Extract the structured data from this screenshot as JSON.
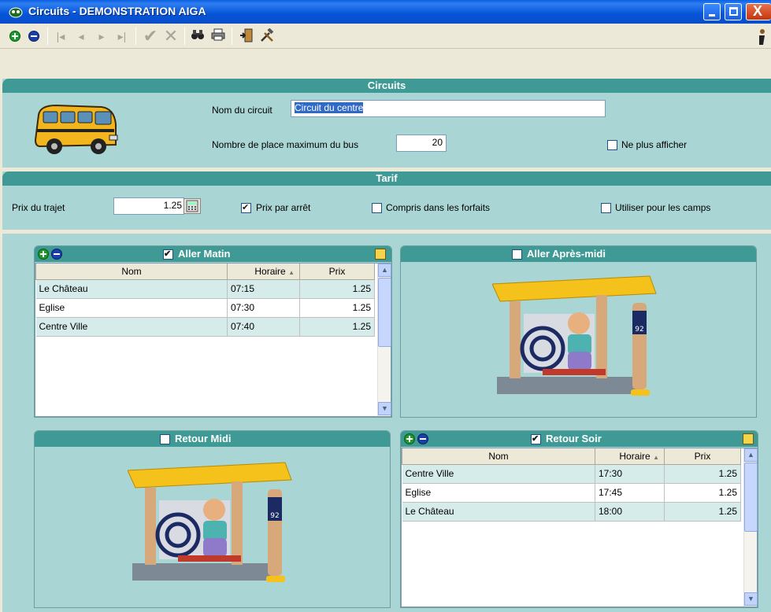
{
  "window": {
    "title": "Circuits - DEMONSTRATION AIGA",
    "close_glyph": "X"
  },
  "toolbar": {
    "icons": [
      "add-icon",
      "remove-icon",
      "first-icon",
      "previous-icon",
      "next-icon",
      "last-icon",
      "validate-icon",
      "cancel-icon",
      "search-icon",
      "print-icon",
      "exit-icon",
      "tools-icon",
      "info-icon"
    ]
  },
  "circuits": {
    "header": "Circuits",
    "name_label": "Nom du circuit",
    "name_value": "Circuit du centre",
    "max_seats_label": "Nombre de place maximum du bus",
    "max_seats_value": "20",
    "hide_label": "Ne plus afficher"
  },
  "tarif": {
    "header": "Tarif",
    "price_label": "Prix du trajet",
    "price_value": "1.25",
    "per_stop_label": "Prix par arrêt",
    "per_stop_checked": true,
    "forfaits_label": "Compris dans les forfaits",
    "camps_label": "Utiliser pour les camps"
  },
  "aller_matin": {
    "title": "Aller Matin",
    "checked": true,
    "columns": [
      "Nom",
      "Horaire",
      "Prix"
    ],
    "sort_glyph": "▲",
    "rows": [
      {
        "nom": "Le Château",
        "horaire": "07:15",
        "prix": "1.25"
      },
      {
        "nom": "Eglise",
        "horaire": "07:30",
        "prix": "1.25"
      },
      {
        "nom": "Centre Ville",
        "horaire": "07:40",
        "prix": "1.25"
      }
    ]
  },
  "aller_apres_midi": {
    "title": "Aller Après-midi",
    "checked": false,
    "sign_number": "92"
  },
  "retour_midi": {
    "title": "Retour Midi",
    "checked": false,
    "sign_number": "92"
  },
  "retour_soir": {
    "title": "Retour Soir",
    "checked": true,
    "columns": [
      "Nom",
      "Horaire",
      "Prix"
    ],
    "sort_glyph": "▲",
    "rows": [
      {
        "nom": "Centre Ville",
        "horaire": "17:30",
        "prix": "1.25"
      },
      {
        "nom": "Eglise",
        "horaire": "17:45",
        "prix": "1.25"
      },
      {
        "nom": "Le Château",
        "horaire": "18:00",
        "prix": "1.25"
      }
    ]
  }
}
